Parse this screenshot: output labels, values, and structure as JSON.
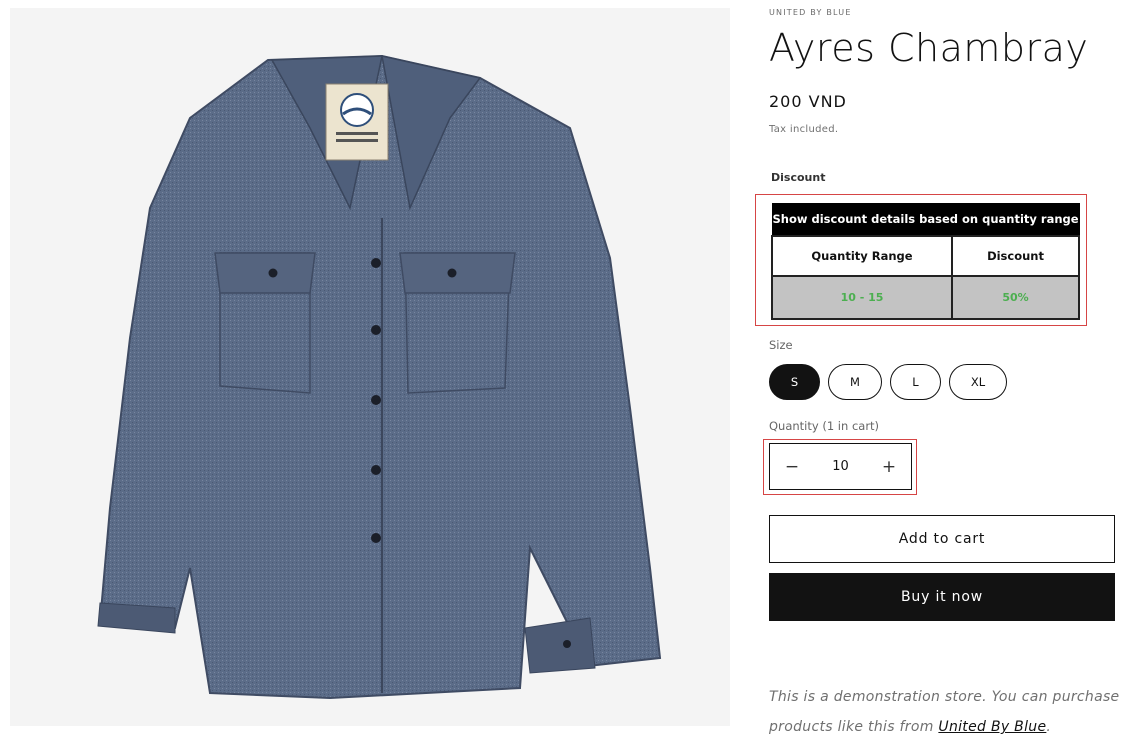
{
  "product": {
    "vendor": "UNITED BY BLUE",
    "title": "Ayres Chambray",
    "price": "200 VND",
    "tax_note": "Tax included.",
    "image_alt": "Ayres Chambray"
  },
  "discount": {
    "label": "Discount",
    "caption": "Show discount details based on quantity range",
    "headers": [
      "Quantity Range",
      "Discount"
    ],
    "rows": [
      [
        "10 - 15",
        "50%"
      ]
    ],
    "text_color": "#4caf50"
  },
  "size": {
    "label": "Size",
    "options": [
      "S",
      "M",
      "L",
      "XL"
    ],
    "selected": "S"
  },
  "quantity": {
    "label": "Quantity (1 in cart)",
    "value": "10",
    "minus": "−",
    "plus": "+"
  },
  "buttons": {
    "add_to_cart": "Add to cart",
    "buy_now": "Buy it now"
  },
  "description": {
    "text": "This is a demonstration store. You can purchase products like this from ",
    "link": "United By Blue",
    "end": "."
  },
  "colors": {
    "highlight_border": "#d64545",
    "button_dark": "#121212",
    "shirt": "#5a6b86"
  }
}
